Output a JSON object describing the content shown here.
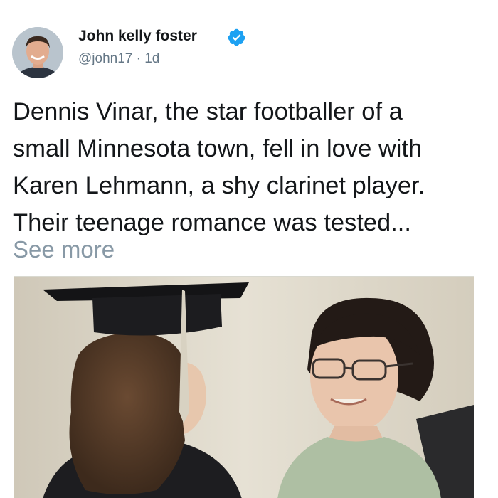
{
  "author": {
    "name": "John kelly foster",
    "handle": "@john17",
    "separator": "·",
    "time": "1d"
  },
  "tweet": {
    "lines": [
      "Dennis Vinar, the star footballer of a",
      "small Minnesota town, fell in love with",
      "Karen Lehmann, a shy clarinet player.",
      "Their teenage romance was tested..."
    ],
    "see_more_label": "See more"
  },
  "icons": {
    "verified": "verified-badge-icon",
    "avatar": "profile-photo"
  },
  "colors": {
    "verified_blue": "#1da1f2",
    "secondary_text": "#657786",
    "see_more": "#8899a6"
  }
}
